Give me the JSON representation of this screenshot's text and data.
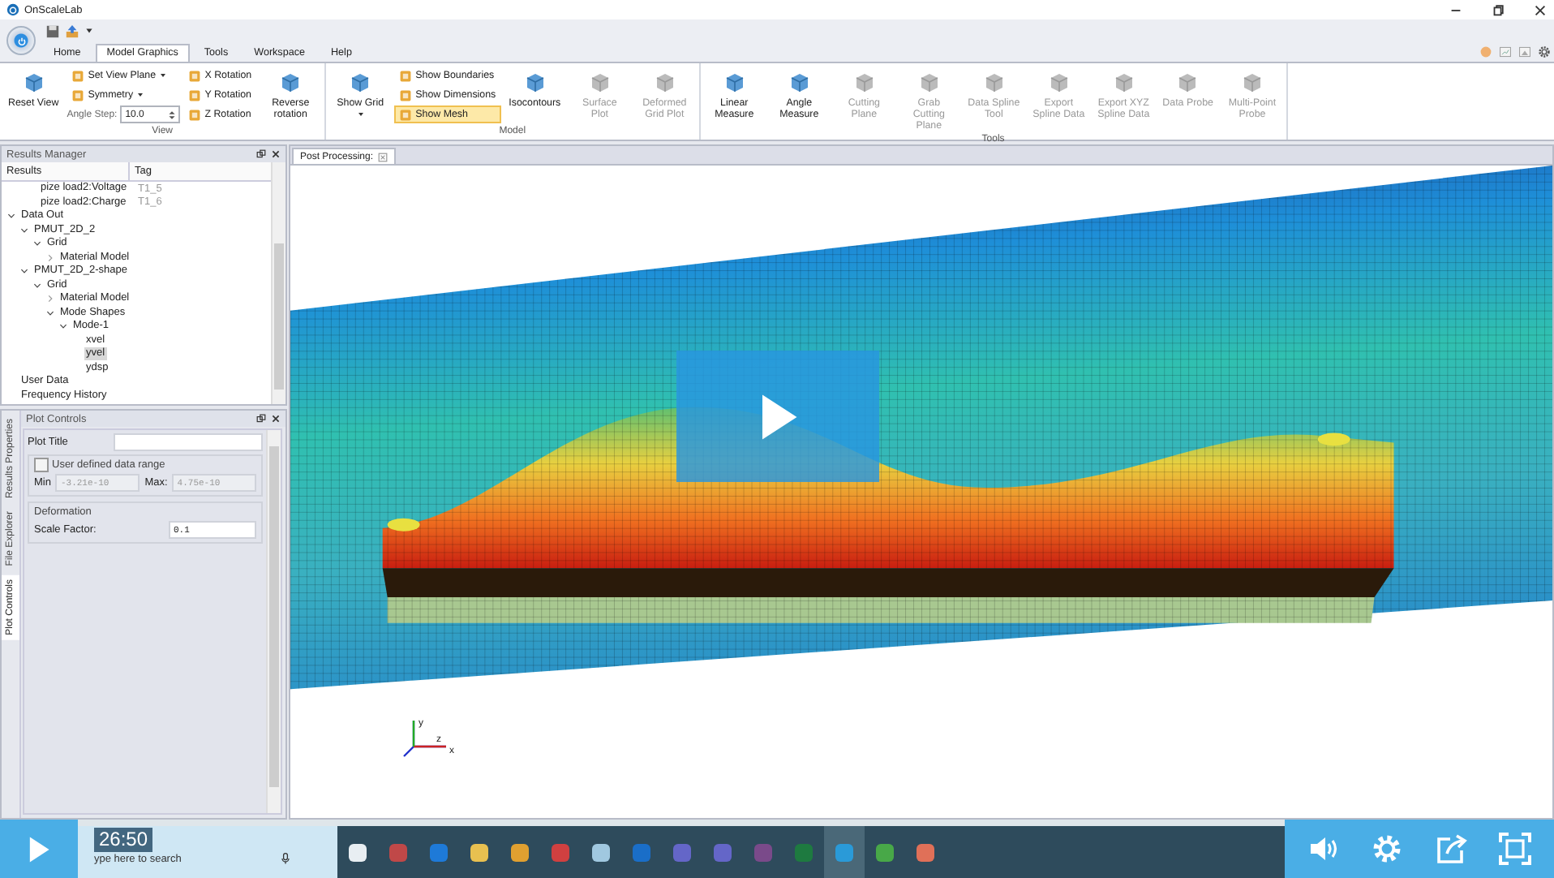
{
  "window": {
    "title": "OnScaleLab"
  },
  "ribbon": {
    "tabs": [
      {
        "label": "Home",
        "selected": false
      },
      {
        "label": "Model Graphics",
        "selected": true
      },
      {
        "label": "Tools",
        "selected": false
      },
      {
        "label": "Workspace",
        "selected": false
      },
      {
        "label": "Help",
        "selected": false
      }
    ],
    "groups": [
      {
        "label": "View",
        "columns": [
          [
            {
              "kind": "large",
              "label": "Reset View",
              "disabled": false,
              "on": false,
              "dropdown": false
            }
          ],
          [
            {
              "kind": "small",
              "label": "Set View Plane",
              "disabled": false,
              "on": false,
              "dropdown": true
            },
            {
              "kind": "small",
              "label": "Symmetry",
              "disabled": false,
              "on": false,
              "dropdown": true
            },
            {
              "kind": "spinner",
              "label": "Angle Step:",
              "value": "10.0",
              "disabled": false
            }
          ],
          [
            {
              "kind": "small",
              "label": "X Rotation",
              "disabled": false,
              "on": false,
              "dropdown": false
            },
            {
              "kind": "small",
              "label": "Y Rotation",
              "disabled": false,
              "on": false,
              "dropdown": false
            },
            {
              "kind": "small",
              "label": "Z Rotation",
              "disabled": false,
              "on": false,
              "dropdown": false
            }
          ],
          [
            {
              "kind": "large",
              "label": "Reverse rotation",
              "disabled": false,
              "on": false,
              "dropdown": false
            }
          ]
        ]
      },
      {
        "label": "Model",
        "columns": [
          [
            {
              "kind": "large",
              "label": "Show Grid",
              "disabled": false,
              "on": false,
              "dropdown": true
            }
          ],
          [
            {
              "kind": "small",
              "label": "Show Boundaries",
              "disabled": false,
              "on": false,
              "dropdown": false
            },
            {
              "kind": "small",
              "label": "Show Dimensions",
              "disabled": false,
              "on": false,
              "dropdown": false
            },
            {
              "kind": "small",
              "label": "Show Mesh",
              "disabled": false,
              "on": true,
              "dropdown": false
            }
          ],
          [
            {
              "kind": "large",
              "label": "Isocontours",
              "disabled": false,
              "on": false,
              "dropdown": false
            }
          ],
          [
            {
              "kind": "large",
              "label": "Surface Plot",
              "disabled": true,
              "on": false,
              "dropdown": false
            }
          ],
          [
            {
              "kind": "large",
              "label": "Deformed Grid Plot",
              "disabled": true,
              "on": false,
              "dropdown": false
            }
          ]
        ]
      },
      {
        "label": "Tools",
        "columns": [
          [
            {
              "kind": "large",
              "label": "Linear Measure",
              "disabled": false,
              "on": false,
              "dropdown": false
            }
          ],
          [
            {
              "kind": "large",
              "label": "Angle Measure",
              "disabled": false,
              "on": false,
              "dropdown": false
            }
          ],
          [
            {
              "kind": "large",
              "label": "Cutting Plane",
              "disabled": true,
              "on": false,
              "dropdown": false
            }
          ],
          [
            {
              "kind": "large",
              "label": "Grab Cutting Plane",
              "disabled": true,
              "on": false,
              "dropdown": false
            }
          ],
          [
            {
              "kind": "large",
              "label": "Data Spline Tool",
              "disabled": true,
              "on": false,
              "dropdown": false
            }
          ],
          [
            {
              "kind": "large",
              "label": "Export Spline Data",
              "disabled": true,
              "on": false,
              "dropdown": false
            }
          ],
          [
            {
              "kind": "large",
              "label": "Export XYZ Spline Data",
              "disabled": true,
              "on": false,
              "dropdown": false
            }
          ],
          [
            {
              "kind": "large",
              "label": "Data Probe",
              "disabled": true,
              "on": false,
              "dropdown": false
            }
          ],
          [
            {
              "kind": "large",
              "label": "Multi-Point Probe",
              "disabled": true,
              "on": false,
              "dropdown": false
            }
          ]
        ]
      }
    ]
  },
  "results_manager": {
    "title": "Results Manager",
    "columns": [
      "Results",
      "Tag"
    ],
    "partial_rows": [
      {
        "label": "pize load2:Voltage",
        "tag": "T1_5"
      },
      {
        "label": "pize load2:Charge",
        "tag": "T1_6"
      }
    ],
    "tree": [
      {
        "label": "Data Out",
        "expanded": true,
        "selected": false,
        "children": [
          {
            "label": "PMUT_2D_2",
            "expanded": true,
            "selected": false,
            "children": [
              {
                "label": "Grid",
                "expanded": true,
                "selected": false,
                "children": [
                  {
                    "label": "Material Model",
                    "expanded": false,
                    "selected": false
                  }
                ]
              }
            ]
          },
          {
            "label": "PMUT_2D_2-shape",
            "expanded": true,
            "selected": false,
            "children": [
              {
                "label": "Grid",
                "expanded": true,
                "selected": false,
                "children": [
                  {
                    "label": "Material Model",
                    "expanded": false,
                    "selected": false
                  },
                  {
                    "label": "Mode Shapes",
                    "expanded": true,
                    "selected": false,
                    "children": [
                      {
                        "label": "Mode-1",
                        "expanded": true,
                        "selected": false,
                        "children": [
                          {
                            "label": "xvel",
                            "selected": false
                          },
                          {
                            "label": "yvel",
                            "selected": true
                          },
                          {
                            "label": "ydsp",
                            "selected": false
                          }
                        ]
                      }
                    ]
                  }
                ]
              }
            ]
          }
        ]
      },
      {
        "label": "User Data",
        "selected": false
      },
      {
        "label": "Frequency History",
        "selected": false
      }
    ]
  },
  "plot_controls": {
    "title": "Plot Controls",
    "side_tabs": [
      {
        "label": "Results Properties",
        "selected": false
      },
      {
        "label": "File Explorer",
        "selected": false
      },
      {
        "label": "Plot Controls",
        "selected": true
      }
    ],
    "plot_title": {
      "label": "Plot Title"
    },
    "range": {
      "label": "User defined data range",
      "checked": false,
      "min_label": "Min",
      "min": "-3.21e-10",
      "max_label": "Max:",
      "max": "4.75e-10"
    },
    "deformation": {
      "label": "Deformation",
      "scale_label": "Scale Factor:",
      "scale": "0.1"
    }
  },
  "viewport": {
    "tab": {
      "label": "Post Processing:",
      "selected": true
    },
    "axis_labels": [
      "y",
      "z",
      "x"
    ]
  },
  "video": {
    "time": "26:50"
  },
  "taskbar": {
    "search_placeholder": "ype here to search",
    "apps": [
      {
        "color": "#e8eef2",
        "active": false
      },
      {
        "color": "#c04848",
        "active": false
      },
      {
        "color": "#1e7ad8",
        "active": false
      },
      {
        "color": "#e8c050",
        "active": false
      },
      {
        "color": "#e0a030",
        "active": false
      },
      {
        "color": "#d04040",
        "active": false
      },
      {
        "color": "#a0c8e0",
        "active": false
      },
      {
        "color": "#1a6ec8",
        "active": false
      },
      {
        "color": "#6466c8",
        "active": false
      },
      {
        "color": "#6466c8",
        "active": false
      },
      {
        "color": "#7a4a8a",
        "active": false
      },
      {
        "color": "#1e7a40",
        "active": false
      },
      {
        "color": "#2a9ad8",
        "active": true
      },
      {
        "color": "#48a848",
        "active": false
      },
      {
        "color": "#e07058",
        "active": false
      }
    ]
  }
}
